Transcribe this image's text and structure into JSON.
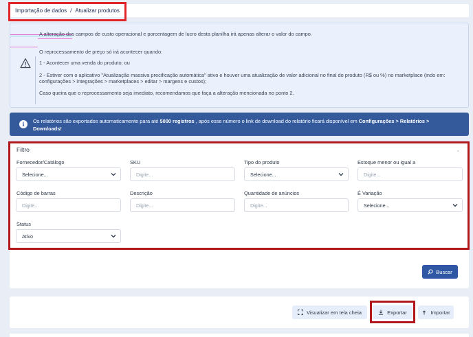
{
  "breadcrumb": {
    "item1": "Importação de dados",
    "separator": "/",
    "item2": "Atualizar produtos"
  },
  "info": {
    "line1": "A alteração dos campos de custo operacional e porcentagem de lucro desta planilha irá apenas alterar o valor do campo.",
    "line2": "O reprocessamento de preço só irá acontecer quando:",
    "line3": "1 - Acontecer uma venda do produto; ou",
    "line4": "2 - Estiver com o aplicativo \"Atualização massiva precificação automática\" ativo e houver uma atualização de valor adicional no final do produto (R$ ou %) no marketplace (indo em:",
    "line5": "configurações > integrações > marketplaces > editar > margens e custos);",
    "line6": "Caso queira que o reprocessamento seja imediato, recomendamos que faça a alteração mencionada no ponto 2."
  },
  "alert": {
    "part1": "Os relatórios são exportados automaticamente para até ",
    "bold1": "5000 registros",
    "part2": " , após esse número o link de download do relatório ficará disponível em ",
    "bold2": "Configurações > Relatórios >",
    "line2": "Downloads!"
  },
  "filter": {
    "title": "Filtro",
    "fields": {
      "fornecedor": {
        "label": "Fornecedor/Catálogo",
        "value": "Selecione..."
      },
      "sku": {
        "label": "SKU",
        "placeholder": "Digite..."
      },
      "tipo": {
        "label": "Tipo do produto",
        "value": "Selecione..."
      },
      "estoque": {
        "label": "Estoque menor ou igual a",
        "placeholder": "Digite..."
      },
      "codigo": {
        "label": "Código de barras",
        "placeholder": "Digite..."
      },
      "descricao": {
        "label": "Descrição",
        "placeholder": "Digite..."
      },
      "quantidade": {
        "label": "Quantidade de anúncios",
        "placeholder": "Digite..."
      },
      "variacao": {
        "label": "É Variação",
        "value": "Selecione..."
      },
      "status": {
        "label": "Status",
        "value": "Ativo"
      }
    }
  },
  "actions": {
    "buscar": "Buscar",
    "tela_cheia": "Visualizar em tela cheia",
    "exportar": "Exportar",
    "importar": "Importar"
  },
  "colors": {
    "primary": "#2f57a4",
    "alert_bg": "#345a9c",
    "highlight": "#e0242a"
  }
}
